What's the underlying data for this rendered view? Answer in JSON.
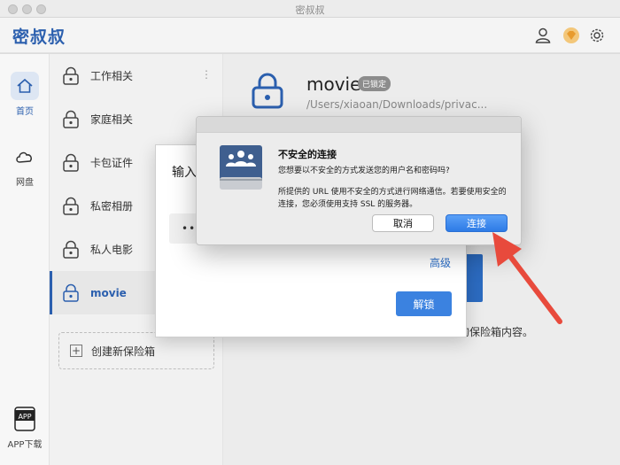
{
  "window": {
    "title": "密叔叔"
  },
  "header": {
    "brand": "密叔叔",
    "icons": [
      "user-icon",
      "diamond-icon",
      "gear-icon"
    ],
    "brand_color": "#2b5fae"
  },
  "rail": {
    "items": [
      {
        "label": "首页",
        "icon": "home-icon"
      },
      {
        "label": "网盘",
        "icon": "cloud-icon"
      },
      {
        "label": "APP下载",
        "icon": "app-icon",
        "badge": "APP"
      }
    ]
  },
  "vaults": {
    "items": [
      {
        "name": "工作相关"
      },
      {
        "name": "家庭相关"
      },
      {
        "name": "卡包证件"
      },
      {
        "name": "私密相册"
      },
      {
        "name": "私人电影"
      },
      {
        "name": "movie"
      }
    ],
    "create_label": "创建新保险箱",
    "more": "⋮"
  },
  "main": {
    "title": "movie",
    "badge": "已锁定",
    "path": "/Users/xiaoan/Downloads/privac...",
    "tail_text": "的保险箱内容。"
  },
  "unlock_sheet": {
    "title": "输入",
    "password_mask": "•••",
    "advanced": "高级",
    "unlock_button": "解锁"
  },
  "alert": {
    "title": "不安全的连接",
    "message": "您想要以不安全的方式发送您的用户名和密码吗?",
    "detail": "所提供的 URL 使用不安全的方式进行网络通信。若要使用安全的连接，您必须使用支持 SSL 的服务器。",
    "cancel": "取消",
    "connect": "连接",
    "icon": "network-drive-icon",
    "accent": "#2d7be6"
  },
  "annotation": {
    "color": "#e84a3c"
  }
}
